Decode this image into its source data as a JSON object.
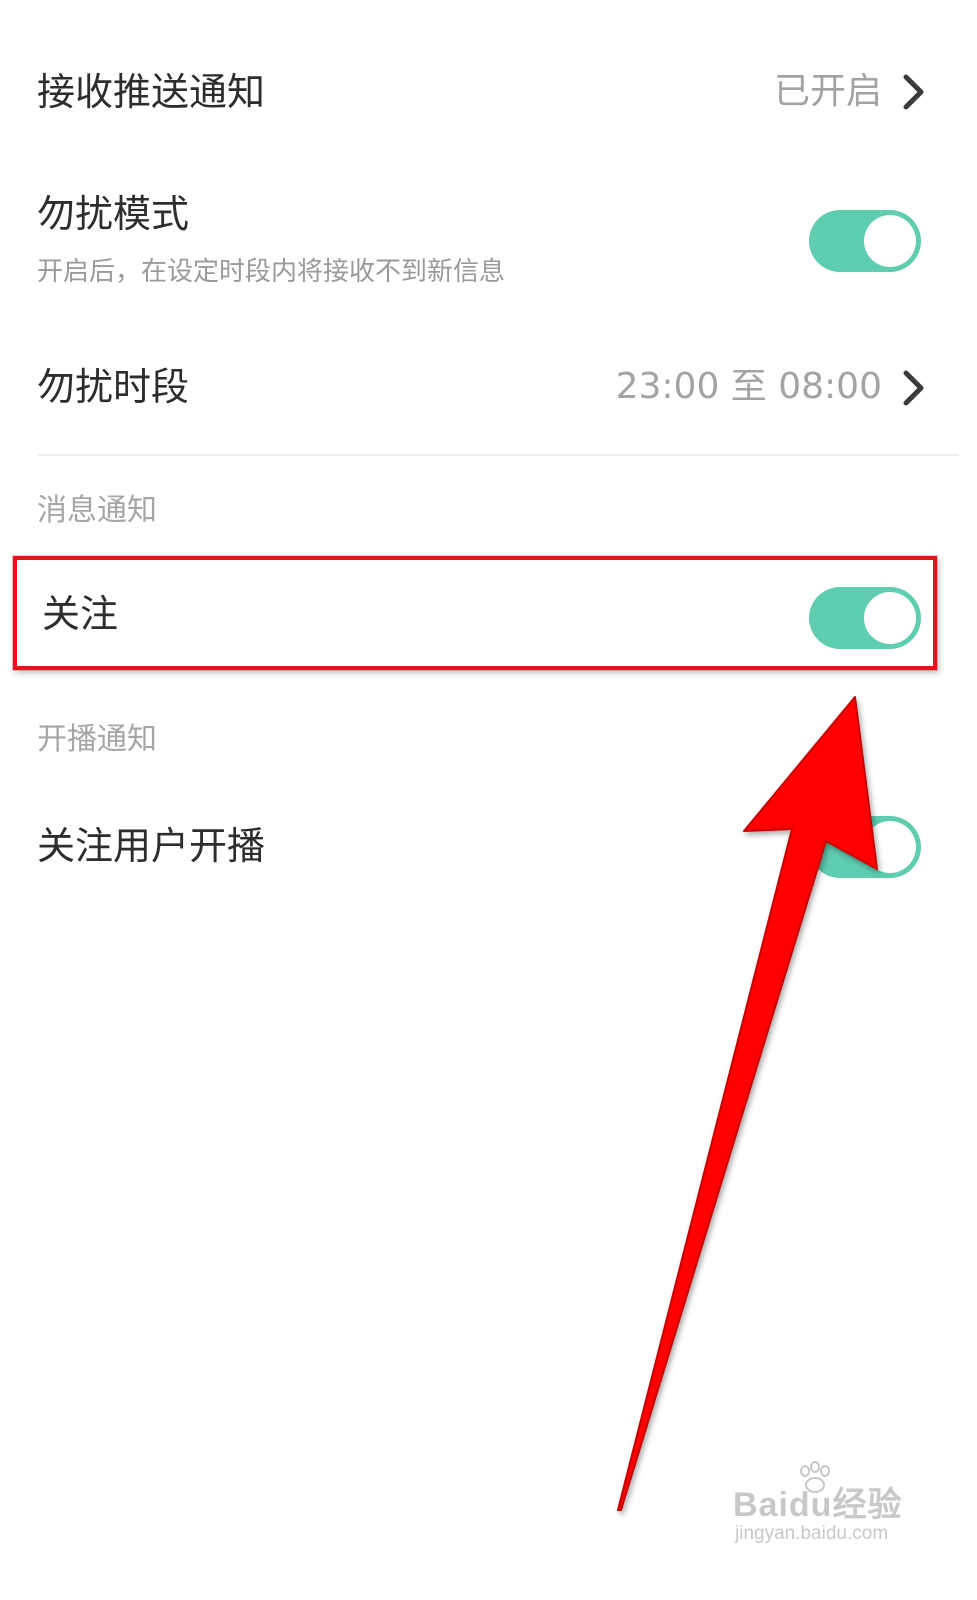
{
  "settings": {
    "push": {
      "title": "接收推送通知",
      "value": "已开启"
    },
    "dnd": {
      "title": "勿扰模式",
      "subtitle": "开启后，在设定时段内将接收不到新信息",
      "enabled": true
    },
    "dnd_period": {
      "title": "勿扰时段",
      "value": "23:00 至 08:00"
    }
  },
  "sections": {
    "message": {
      "header": "消息通知",
      "follow": {
        "title": "关注",
        "enabled": true
      }
    },
    "live": {
      "header": "开播通知",
      "followed_live": {
        "title": "关注用户开播",
        "enabled": true
      }
    }
  },
  "colors": {
    "toggle_on": "#5ecdb0",
    "annotation": "#e8101b"
  },
  "watermark": {
    "brand": "Baidu经验",
    "url": "jingyan.baidu.com"
  }
}
